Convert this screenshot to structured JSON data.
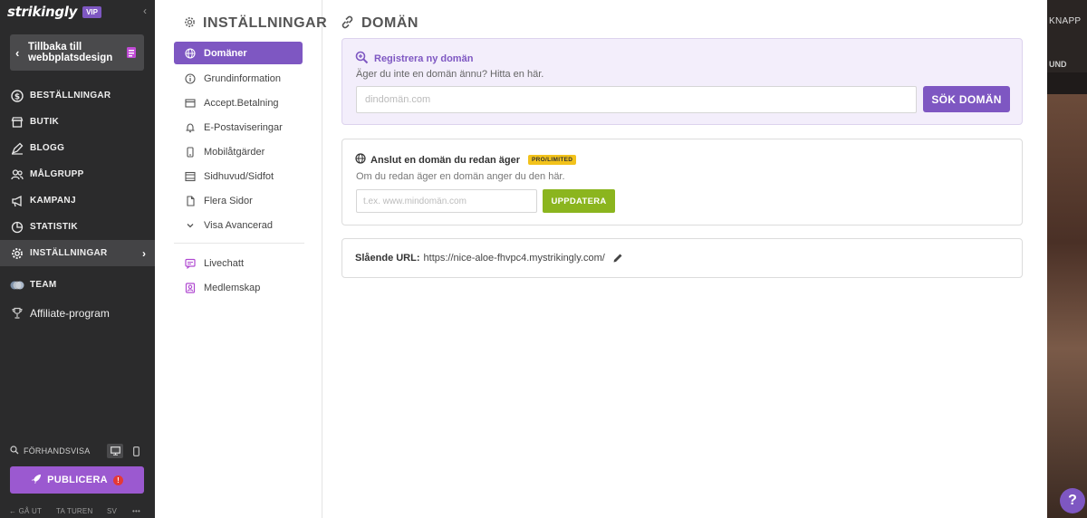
{
  "sidebar": {
    "brand": "strikingly",
    "vip_badge": "VIP",
    "back_label": "Tillbaka till webbplatsdesign",
    "nav": [
      {
        "label": "BESTÄLLNINGAR",
        "icon": "dollar-icon"
      },
      {
        "label": "BUTIK",
        "icon": "store-icon"
      },
      {
        "label": "BLOGG",
        "icon": "pen-icon"
      },
      {
        "label": "MÅLGRUPP",
        "icon": "audience-icon"
      },
      {
        "label": "KAMPANJ",
        "icon": "megaphone-icon"
      },
      {
        "label": "STATISTIK",
        "icon": "pie-chart-icon"
      },
      {
        "label": "INSTÄLLNINGAR",
        "icon": "gear-icon"
      },
      {
        "label": "TEAM",
        "icon": "team-icon"
      },
      {
        "label": "Affiliate-program",
        "icon": "trophy-icon"
      }
    ],
    "preview_label": "FÖRHANDSVISA",
    "publish_label": "PUBLICERA",
    "publish_warning": "!",
    "footer": {
      "logout": "GÅ UT",
      "tour": "TA TUREN",
      "lang": "SV",
      "more": "•••"
    }
  },
  "settings": {
    "title": "INSTÄLLNINGAR",
    "nav": [
      {
        "label": "Domäner",
        "icon": "globe-icon"
      },
      {
        "label": "Grundinformation",
        "icon": "info-icon"
      },
      {
        "label": "Accept.Betalning",
        "icon": "card-icon"
      },
      {
        "label": "E-Postaviseringar",
        "icon": "bell-icon"
      },
      {
        "label": "Mobilåtgärder",
        "icon": "mobile-icon"
      },
      {
        "label": "Sidhuvud/Sidfot",
        "icon": "layout-icon"
      },
      {
        "label": "Flera Sidor",
        "icon": "pages-icon"
      },
      {
        "label": "Visa Avancerad",
        "icon": "chevron-down-icon"
      }
    ],
    "extra": [
      {
        "label": "Livechatt",
        "icon": "chat-icon"
      },
      {
        "label": "Medlemskap",
        "icon": "member-icon"
      }
    ]
  },
  "main": {
    "title": "DOMÄN",
    "register": {
      "title": "Registrera ny domän",
      "subtitle": "Äger du inte en domän ännu? Hitta en här.",
      "placeholder": "dindomän.com",
      "value": "",
      "button": "SÖK DOMÄN"
    },
    "connect": {
      "title": "Anslut en domän du redan äger",
      "badge": "PRO/LIMITED",
      "subtitle": "Om du redan äger en domän anger du den här.",
      "placeholder": "t.ex. www.mindomän.com",
      "value": "",
      "button": "UPPDATERA"
    },
    "url": {
      "label": "Slående URL:",
      "value": "https://nice-aloe-fhvpc4.mystrikingly.com/"
    }
  },
  "preview": {
    "top_text": "KNAPP",
    "mid_text": "UND",
    "help": "?"
  },
  "colors": {
    "accent": "#7e57c2",
    "publish": "#9b59d0",
    "update": "#8bb51e",
    "badge": "#f2c21b",
    "sidebar": "#2b2b2c"
  }
}
